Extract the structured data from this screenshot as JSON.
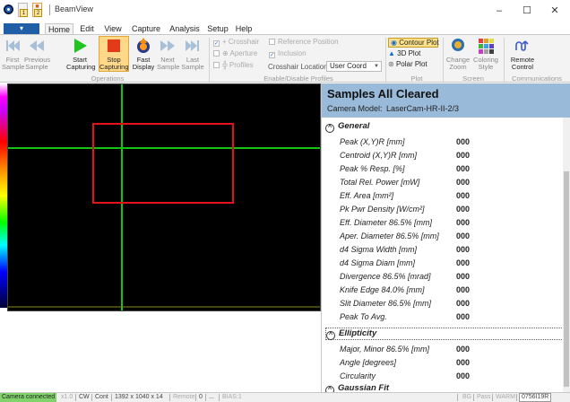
{
  "window": {
    "title": "BeamView",
    "minimize": "–",
    "maximize": "☐",
    "close": "✕"
  },
  "quick_access": [
    "1",
    "2"
  ],
  "tabs": [
    "Home",
    "Edit",
    "View",
    "Capture",
    "Analysis",
    "Setup",
    "Help"
  ],
  "ribbon": {
    "operations": {
      "label": "Operations",
      "buttons": [
        {
          "line1": "First",
          "line2": "Sample",
          "icon": "first-sample-icon"
        },
        {
          "line1": "Previous",
          "line2": "Sample",
          "icon": "previous-sample-icon"
        },
        {
          "line1": "Start",
          "line2": "Capturing",
          "icon": "start-capturing-icon"
        },
        {
          "line1": "Stop",
          "line2": "Capturing",
          "icon": "stop-capturing-icon"
        },
        {
          "line1": "Fast",
          "line2": "Display",
          "icon": "fast-display-icon"
        },
        {
          "line1": "Next",
          "line2": "Sample",
          "icon": "next-sample-icon"
        },
        {
          "line1": "Last",
          "line2": "Sample",
          "icon": "last-sample-icon"
        }
      ]
    },
    "enable": {
      "label": "Enable/Disable Profiles",
      "crosshair": "Crosshair",
      "aperture": "Aperture",
      "profiles": "Profiles",
      "reference_position": "Reference Position",
      "inclusion": "Inclusion",
      "crosshair_location_label": "Crosshair Location:",
      "crosshair_location_value": "User Coord"
    },
    "plot": {
      "label": "Plot",
      "contour": "Contour Plot",
      "plot3d": "3D Plot",
      "polar": "Polar Plot"
    },
    "screen": {
      "label": "Screen",
      "change_zoom_1": "Change",
      "change_zoom_2": "Zoom",
      "coloring_1": "Coloring",
      "coloring_2": "Style"
    },
    "communications": {
      "label": "Communications",
      "remote_1": "Remote",
      "remote_2": "Control"
    }
  },
  "panel": {
    "title": "Samples All Cleared",
    "model_label": "Camera Model:",
    "model_value": "LaserCam-HR-II-2/3",
    "general_label": "General",
    "general_rows": [
      {
        "label": "Peak (X,Y)R [mm]",
        "value": "000"
      },
      {
        "label": "Centroid (X,Y)R [mm]",
        "value": "000"
      },
      {
        "label": "Peak % Resp. [%]",
        "value": "000"
      },
      {
        "label": "Total Rel. Power  [mW]",
        "value": "000"
      },
      {
        "label": "Eff. Area [mm²]",
        "value": "000"
      },
      {
        "label": "Pk Pwr Density [W/cm²]",
        "value": "000"
      },
      {
        "label": "Eff. Diameter 86.5% [mm]",
        "value": "000"
      },
      {
        "label": "Aper. Diameter 86.5% [mm]",
        "value": "000"
      },
      {
        "label": "d4 Sigma Width [mm]",
        "value": "000"
      },
      {
        "label": "d4 Sigma Diam [mm]",
        "value": "000"
      },
      {
        "label": "Divergence 86.5% [mrad]",
        "value": "000"
      },
      {
        "label": "Knife Edge 84.0% [mm]",
        "value": "000"
      },
      {
        "label": "Slit Diameter 86.5% [mm]",
        "value": "000"
      },
      {
        "label": "Peak To Avg.",
        "value": "000"
      }
    ],
    "ellipticity_label": "Ellipticity",
    "ellipticity_rows": [
      {
        "label": "Major, Minor 86.5% [mm]",
        "value": "000"
      },
      {
        "label": "Angle [degrees]",
        "value": "000"
      },
      {
        "label": "Circularity",
        "value": "000"
      }
    ],
    "gaussian_label": "Gaussian Fit"
  },
  "status": {
    "connected": "Camera connected",
    "gain": "x1.0",
    "mode": "CW",
    "cont": "Cont",
    "resolution": "1392 x 1040 x 14",
    "remote": "Remote",
    "count": "0",
    "dots": "...",
    "bias": "BIAS:1",
    "bg": "BG",
    "pass": "Pass",
    "warm": "WARM",
    "serial": "0756I19R"
  },
  "colors": {
    "accent": "#1f5fa8",
    "panel_header": "#99bbd9",
    "crosshair": "#14c414",
    "roi_box": "#e0141a",
    "connected": "#7fd36a"
  }
}
